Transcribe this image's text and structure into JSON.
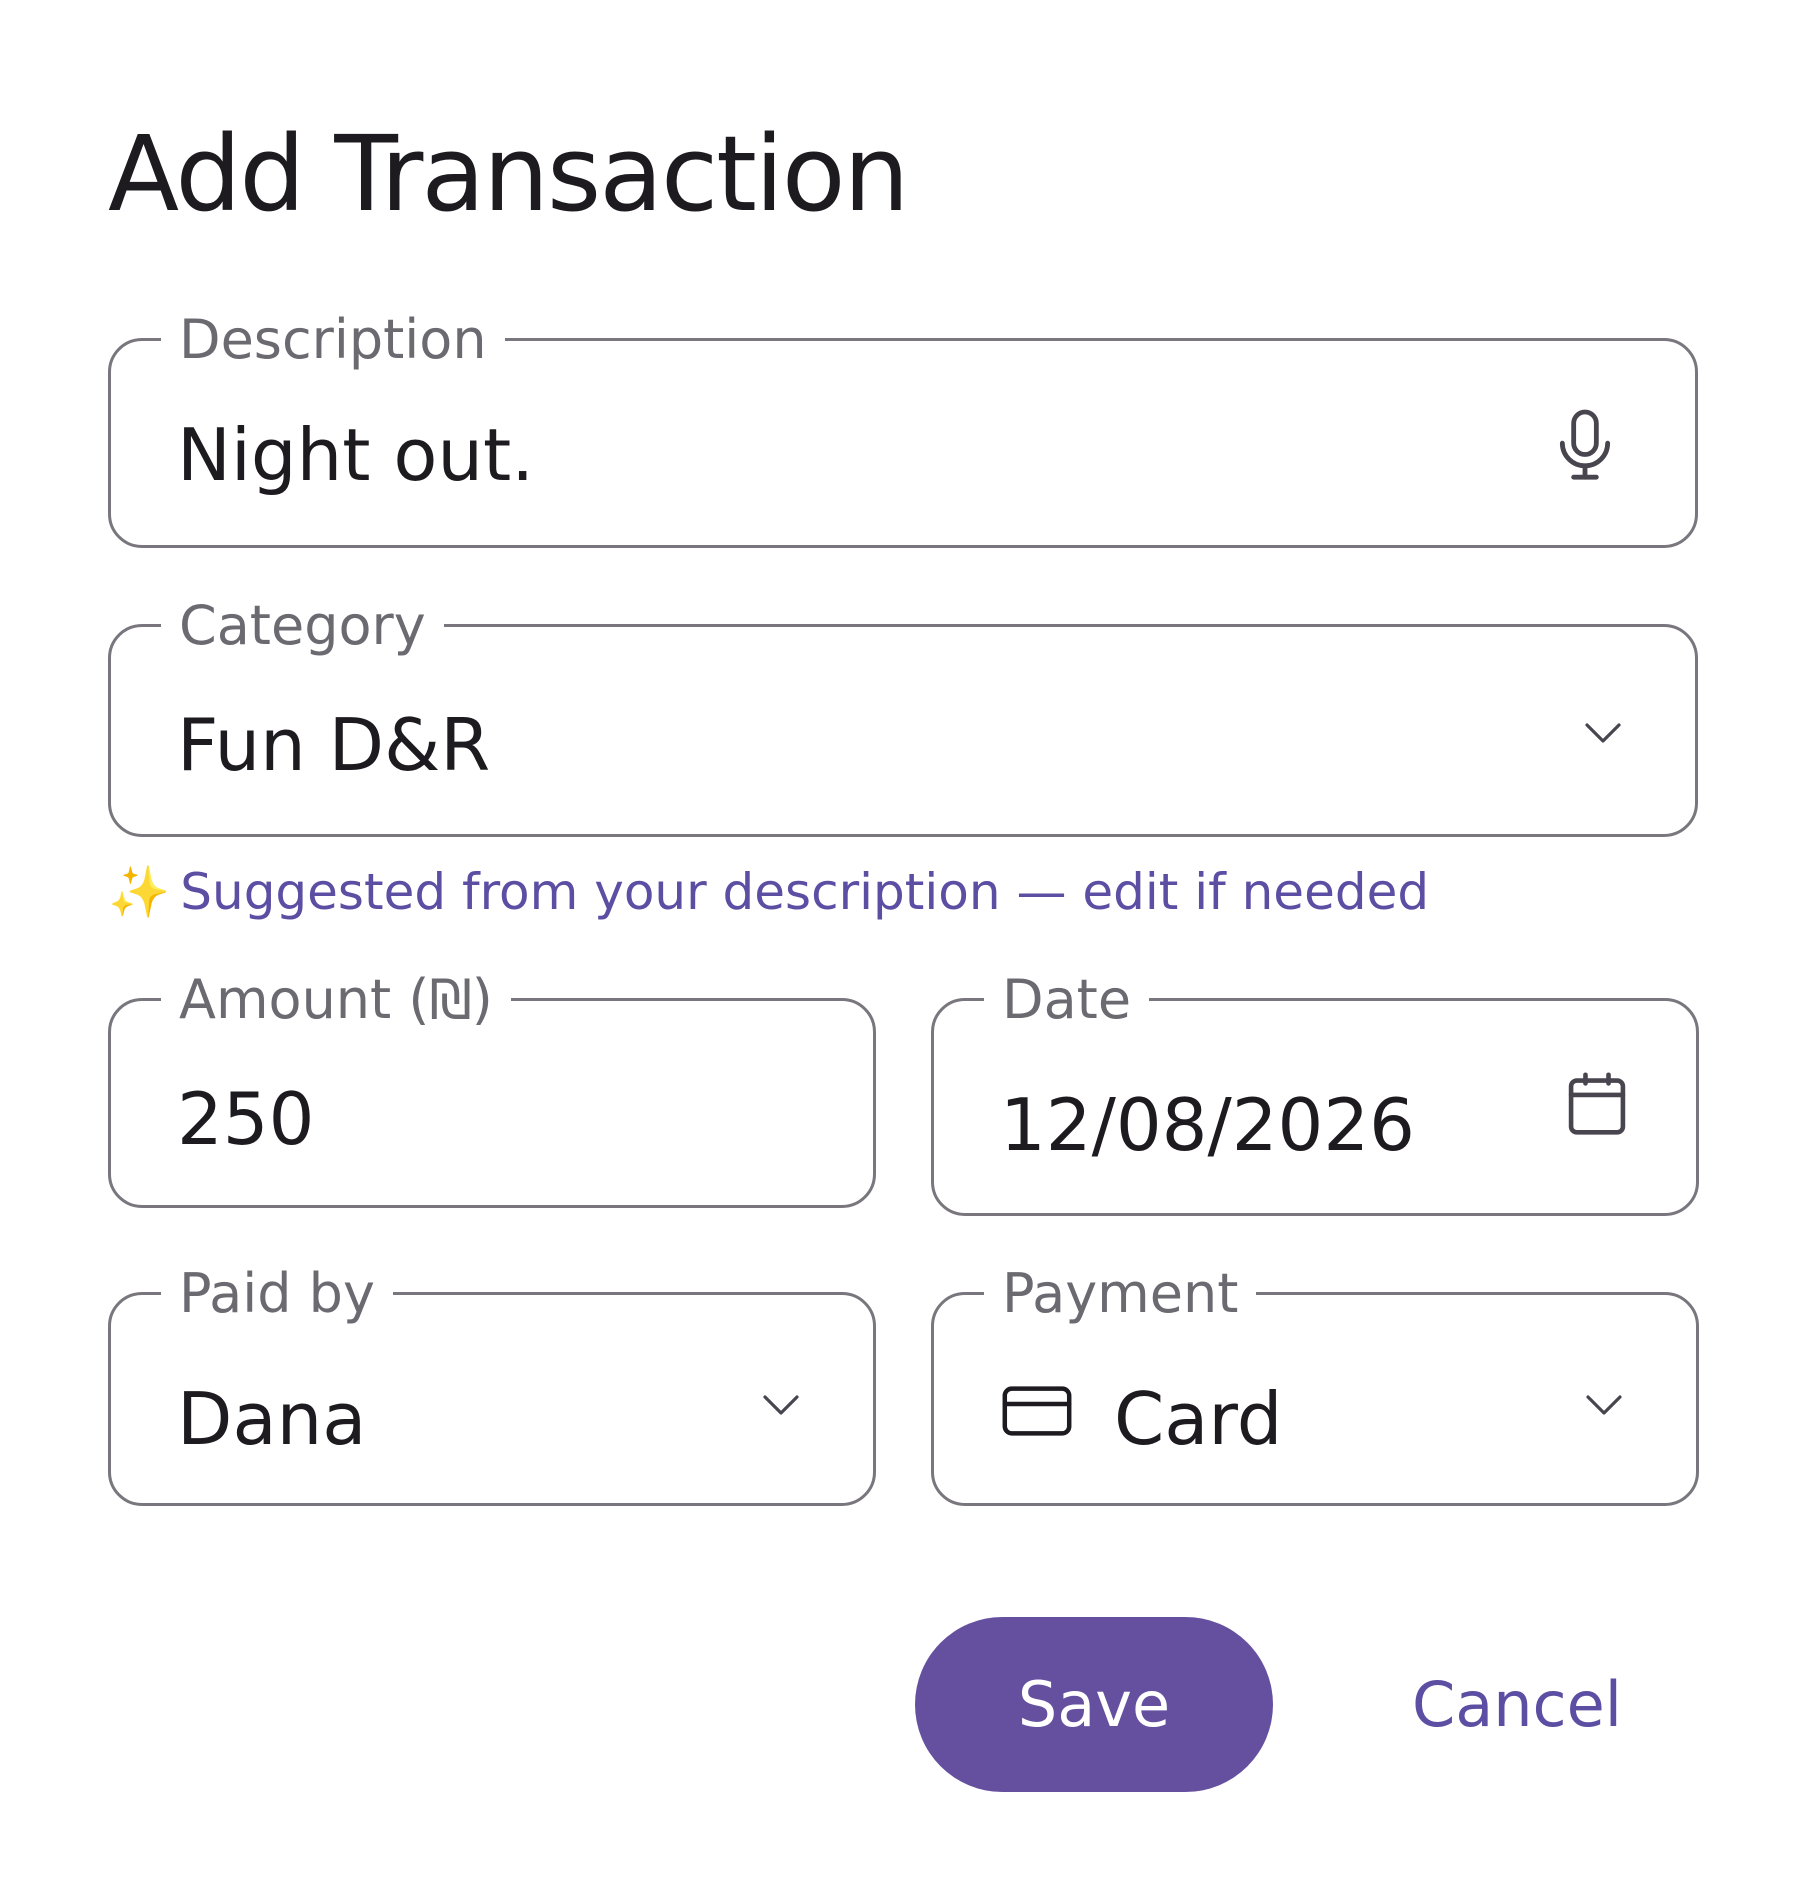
{
  "dialog": {
    "title": "Add Transaction"
  },
  "fields": {
    "description": {
      "label": "Description",
      "value": "Night out.",
      "icon": "mic-icon"
    },
    "category": {
      "label": "Category",
      "value": "Fun D&R",
      "icon": "chevron-down-icon"
    },
    "category_hint": {
      "sparkle": "✨",
      "text": "Suggested from your description — edit if needed"
    },
    "amount": {
      "label": "Amount (₪)",
      "value": "250"
    },
    "date": {
      "label": "Date",
      "value": "12/08/2026",
      "icon": "calendar-icon"
    },
    "paid_by": {
      "label": "Paid by",
      "value": "Dana",
      "icon": "chevron-down-icon"
    },
    "payment": {
      "label": "Payment",
      "value": "Card",
      "leading_icon": "credit-card-icon",
      "icon": "chevron-down-icon"
    }
  },
  "actions": {
    "save_label": "Save",
    "cancel_label": "Cancel"
  },
  "colors": {
    "accent": "#6550a0",
    "accent_text": "#5b4ea3",
    "outline": "#79767d",
    "label": "#6c6a71",
    "text": "#1d1b20"
  }
}
